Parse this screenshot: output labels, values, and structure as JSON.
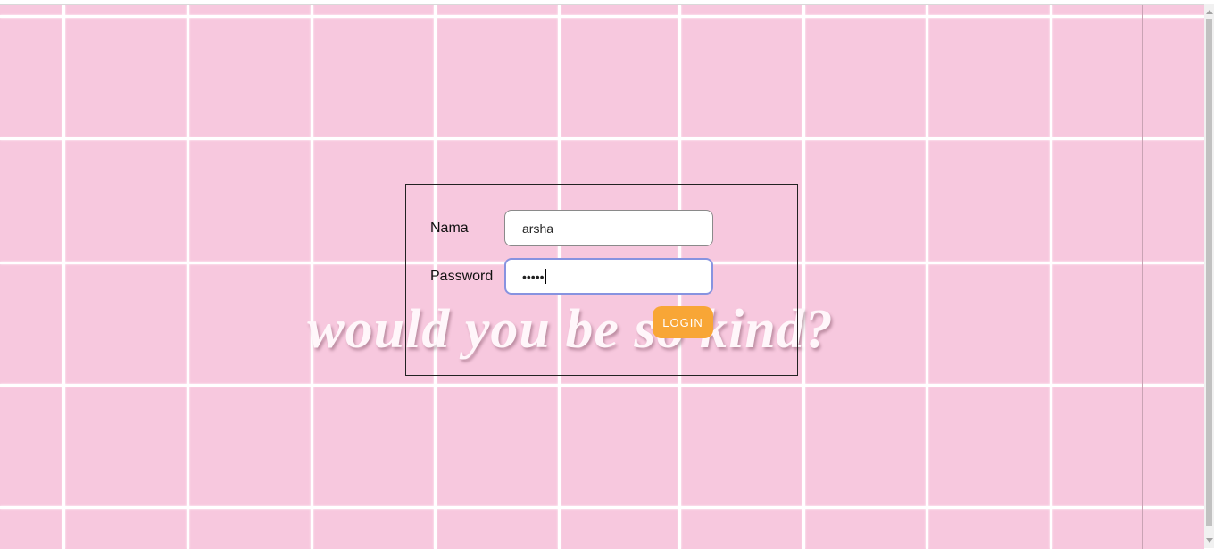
{
  "background": {
    "color": "#f7c8de",
    "grid_color": "#ffffff",
    "tagline": "would you be so kind?"
  },
  "form": {
    "nama_label": "Nama",
    "nama_value": "arsha",
    "password_label": "Password",
    "password_value": "•••••",
    "login_label": "LOGIN",
    "login_color": "#f8a636"
  }
}
